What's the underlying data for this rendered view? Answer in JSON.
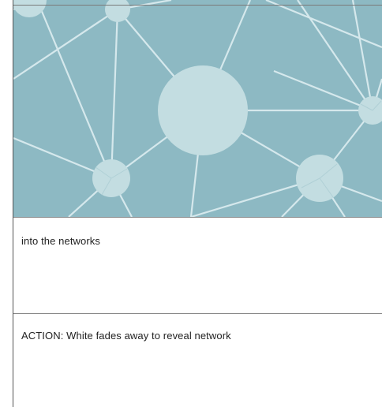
{
  "storyboard": {
    "frame_illustration": {
      "icon": "network-illustration",
      "background_color": "#8db9c3",
      "node_color": "#c3dde1",
      "line_color": "#d5e8ec"
    },
    "narration_text": "into the networks",
    "action_text": "ACTION: White fades away to reveal network"
  }
}
